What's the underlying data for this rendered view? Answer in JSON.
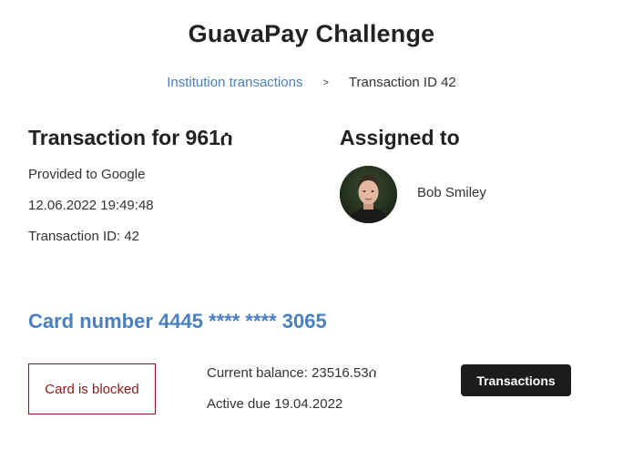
{
  "app": {
    "title": "GuavaPay Challenge"
  },
  "breadcrumb": {
    "parent_label": "Institution transactions",
    "separator": ">",
    "current_label": "Transaction ID 42"
  },
  "transaction": {
    "title": "Transaction for 961ሰ",
    "provider": "Provided to Google",
    "datetime": "12.06.2022 19:49:48",
    "id_label": "Transaction ID: 42"
  },
  "assignment": {
    "title": "Assigned to",
    "assignee_name": "Bob Smiley",
    "avatar_icon": "user-avatar-photo"
  },
  "card": {
    "number_label": "Card number 4445 **** **** 3065",
    "status": "Card is blocked",
    "balance": "Current balance: 23516.53ሰ",
    "active_due": "Active due 19.04.2022",
    "transactions_button": "Transactions"
  },
  "colors": {
    "link": "#4a7fc0",
    "blocked": "#8b1a1a",
    "button_bg": "#1c1c1c"
  }
}
